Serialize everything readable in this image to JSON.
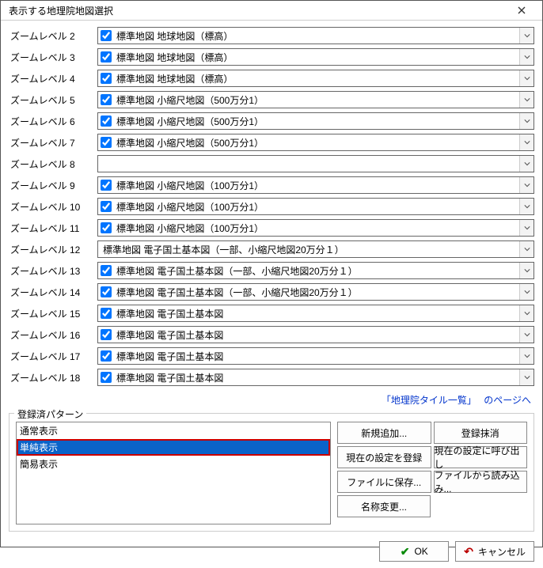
{
  "title": "表示する地理院地図選択",
  "zoom_rows": [
    {
      "label": "ズームレベル 2",
      "checked": true,
      "text": "標準地図 地球地図（標高）"
    },
    {
      "label": "ズームレベル 3",
      "checked": true,
      "text": "標準地図 地球地図（標高）"
    },
    {
      "label": "ズームレベル 4",
      "checked": true,
      "text": "標準地図 地球地図（標高）"
    },
    {
      "label": "ズームレベル 5",
      "checked": true,
      "text": "標準地図 小縮尺地図（500万分1）"
    },
    {
      "label": "ズームレベル 6",
      "checked": true,
      "text": "標準地図 小縮尺地図（500万分1）"
    },
    {
      "label": "ズームレベル 7",
      "checked": true,
      "text": "標準地図 小縮尺地図（500万分1）"
    },
    {
      "label": "ズームレベル 8",
      "checked": null,
      "text": ""
    },
    {
      "label": "ズームレベル 9",
      "checked": true,
      "text": "標準地図 小縮尺地図（100万分1）"
    },
    {
      "label": "ズームレベル 10",
      "checked": true,
      "text": "標準地図 小縮尺地図（100万分1）"
    },
    {
      "label": "ズームレベル 11",
      "checked": true,
      "text": "標準地図 小縮尺地図（100万分1）"
    },
    {
      "label": "ズームレベル 12",
      "checked": null,
      "text": "標準地図 電子国土基本図（一部、小縮尺地図20万分１）"
    },
    {
      "label": "ズームレベル 13",
      "checked": true,
      "text": "標準地図 電子国土基本図（一部、小縮尺地図20万分１）"
    },
    {
      "label": "ズームレベル 14",
      "checked": true,
      "text": "標準地図 電子国土基本図（一部、小縮尺地図20万分１）"
    },
    {
      "label": "ズームレベル 15",
      "checked": true,
      "text": "標準地図 電子国土基本図"
    },
    {
      "label": "ズームレベル 16",
      "checked": true,
      "text": "標準地図 電子国土基本図"
    },
    {
      "label": "ズームレベル 17",
      "checked": true,
      "text": "標準地図 電子国土基本図"
    },
    {
      "label": "ズームレベル 18",
      "checked": true,
      "text": "標準地図 電子国土基本図"
    }
  ],
  "links": {
    "tile_list": "「地理院タイル一覧」",
    "to_page": "のページへ"
  },
  "group": {
    "legend": "登録済パターン",
    "items": [
      {
        "label": "通常表示",
        "selected": false
      },
      {
        "label": "単純表示",
        "selected": true
      },
      {
        "label": "簡易表示",
        "selected": false
      }
    ],
    "buttons": {
      "new_add": "新規追加...",
      "delete": "登録抹消",
      "save_current": "現在の設定を登録",
      "load_current": "現在の設定に呼び出し",
      "save_file": "ファイルに保存...",
      "load_file": "ファイルから読み込み...",
      "rename": "名称変更..."
    }
  },
  "footer": {
    "ok": "OK",
    "cancel": "キャンセル"
  }
}
